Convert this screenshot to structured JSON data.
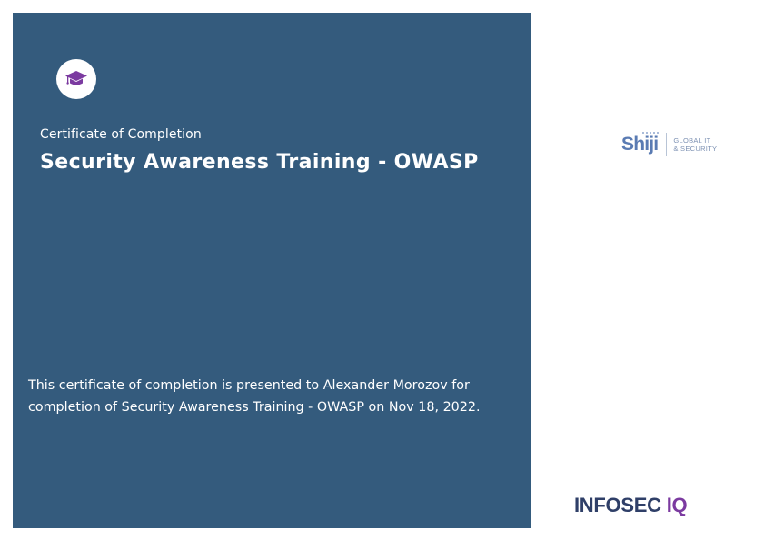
{
  "certificate": {
    "label": "Certificate of Completion",
    "title": "Security Awareness Training - OWASP",
    "body": "This certificate of completion is presented to Alexander Morozov for completion of Security Awareness Training - OWASP on Nov 18, 2022.",
    "badge_icon": "graduation-cap-icon"
  },
  "logos": {
    "shiji": {
      "name": "Shiji",
      "tagline_line1": "GLOBAL IT",
      "tagline_line2": "& SECURITY"
    },
    "infosec": {
      "word": "INFOSEC",
      "iq": "IQ"
    }
  },
  "colors": {
    "panel": "#345b7d",
    "badge_icon": "#7b3aa0",
    "infosec_text": "#2f3f68",
    "infosec_iq": "#7b3aa0",
    "shiji": "#5a7bb3"
  }
}
